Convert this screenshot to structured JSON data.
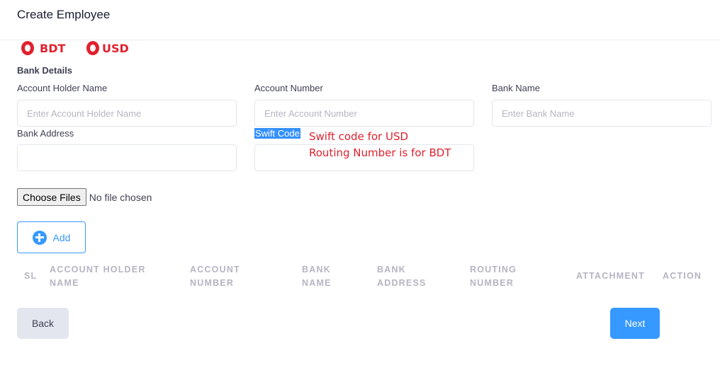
{
  "page": {
    "title": "Create Employee"
  },
  "currency": {
    "bdt": "BDT",
    "usd": "USD"
  },
  "bank": {
    "section_title": "Bank Details",
    "account_holder": {
      "label": "Account Holder Name",
      "placeholder": "Enter Account Holder Name",
      "value": ""
    },
    "account_number": {
      "label": "Account Number",
      "placeholder": "Enter Account Number",
      "value": ""
    },
    "bank_name": {
      "label": "Bank Name",
      "placeholder": "Enter Bank Name",
      "value": ""
    },
    "bank_address": {
      "label": "Bank Address",
      "placeholder": "",
      "value": ""
    },
    "swift_code": {
      "label": "Swift Code",
      "placeholder": "",
      "value": ""
    }
  },
  "annotation": {
    "line1": "Swift code for USD",
    "line2": "Routing Number is for BDT"
  },
  "file": {
    "button_label": "Choose Files",
    "status": "No file chosen"
  },
  "add_button": {
    "label": "Add"
  },
  "table": {
    "headers": {
      "sl": "SL",
      "account_holder": {
        "line1": "ACCOUNT HOLDER",
        "line2": "NAME"
      },
      "account_number": {
        "line1": "ACCOUNT",
        "line2": "NUMBER"
      },
      "bank_name": {
        "line1": "BANK",
        "line2": "NAME"
      },
      "bank_address": {
        "line1": "BANK",
        "line2": "ADDRESS"
      },
      "routing_number": {
        "line1": "ROUTING",
        "line2": "NUMBER"
      },
      "attachment": "ATTACHMENT",
      "action": "ACTION"
    },
    "rows": []
  },
  "footer": {
    "back_label": "Back",
    "next_label": "Next"
  },
  "colors": {
    "primary": "#3699ff",
    "annotation_red": "#e0212e",
    "muted": "#b5b5c3"
  },
  "icons": {
    "add": "plus-circle-icon",
    "radio": "radio-ring-icon"
  }
}
